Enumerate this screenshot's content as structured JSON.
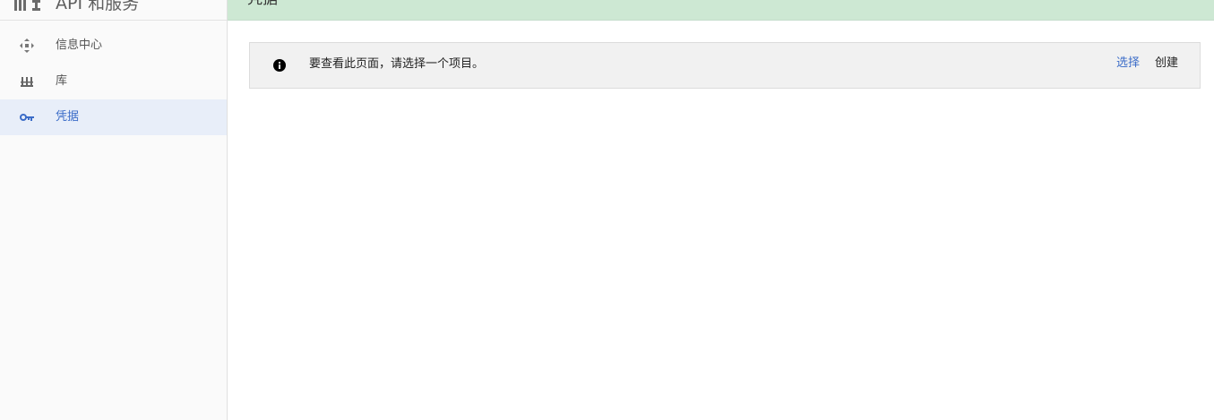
{
  "app": {
    "title": "API 和服务"
  },
  "sidebar": {
    "items": [
      {
        "label": "信息中心",
        "icon": "dashboard-icon",
        "active": false
      },
      {
        "label": "库",
        "icon": "library-icon",
        "active": false
      },
      {
        "label": "凭据",
        "icon": "key-icon",
        "active": true
      }
    ]
  },
  "header": {
    "title": "凭据"
  },
  "banner": {
    "icon": "info-icon",
    "message": "要查看此页面，请选择一个项目。",
    "select_label": "选择",
    "create_label": "创建"
  },
  "colors": {
    "accent": "#3b6cc8",
    "header_bg": "#cde8d3",
    "active_nav_bg": "#e8eef9",
    "banner_bg": "#f1f1f1"
  }
}
